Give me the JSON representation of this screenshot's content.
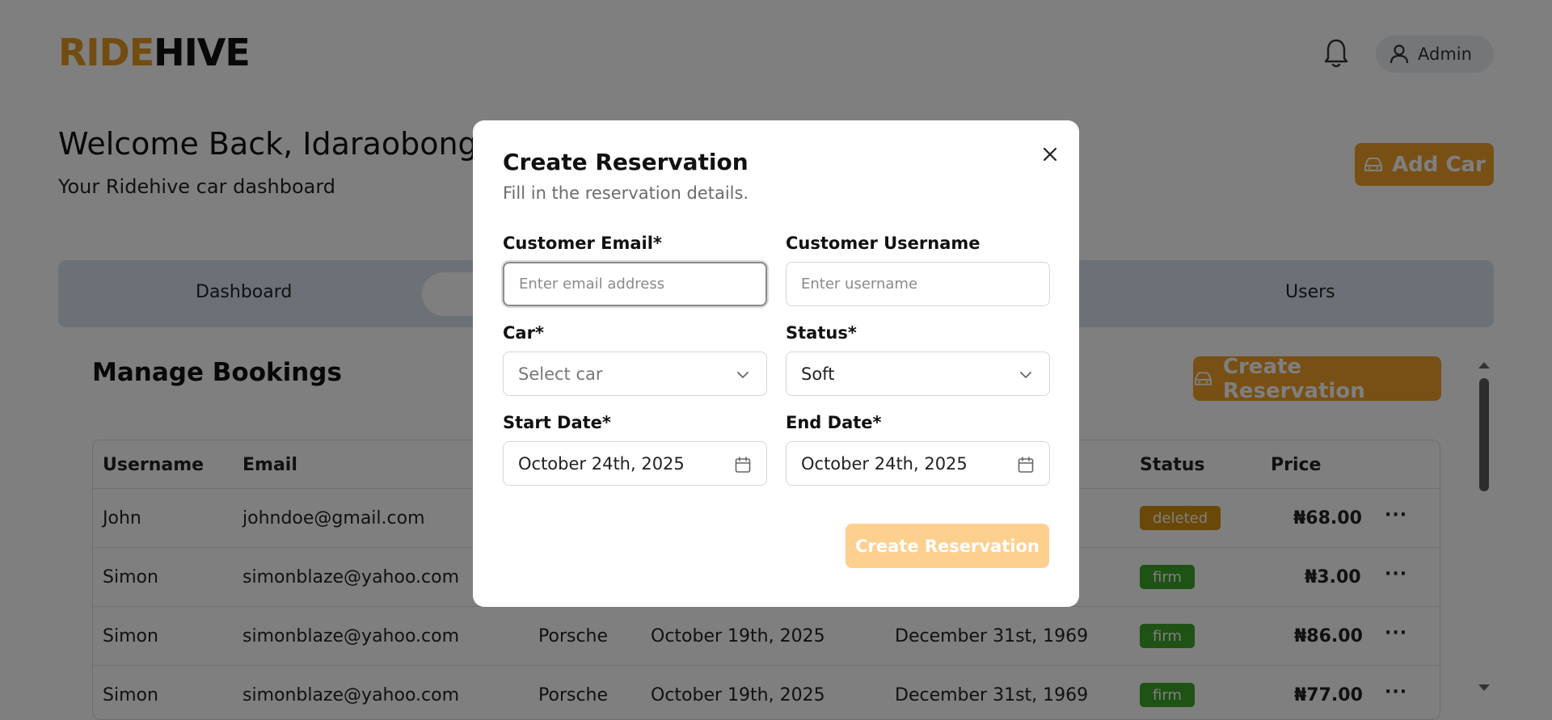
{
  "header": {
    "logo_part1": "RIDE",
    "logo_part2": "HIVE",
    "admin_label": "Admin"
  },
  "welcome": {
    "title": "Welcome Back, Idaraobong!",
    "subtitle": "Your Ridehive car dashboard"
  },
  "add_car_label": "Add Car",
  "tabs": [
    "Dashboard",
    "Users"
  ],
  "bookings": {
    "title": "Manage Bookings",
    "create_label": "Create Reservation",
    "columns": {
      "username": "Username",
      "email": "Email",
      "status": "Status",
      "price": "Price"
    },
    "rows": [
      {
        "username": "John",
        "email": "johndoe@gmail.com",
        "car": "",
        "start": "",
        "end": "",
        "status": "deleted",
        "price": "₦68.00"
      },
      {
        "username": "Simon",
        "email": "simonblaze@yahoo.com",
        "car": "",
        "start": "",
        "end": "",
        "status": "firm",
        "price": "₦3.00"
      },
      {
        "username": "Simon",
        "email": "simonblaze@yahoo.com",
        "car": "Porsche",
        "start": "October 19th, 2025",
        "end": "December 31st, 1969",
        "status": "firm",
        "price": "₦86.00"
      },
      {
        "username": "Simon",
        "email": "simonblaze@yahoo.com",
        "car": "Porsche",
        "start": "October 19th, 2025",
        "end": "December 31st, 1969",
        "status": "firm",
        "price": "₦77.00"
      }
    ],
    "row_actions": "···"
  },
  "colors": {
    "accent": "#f0a12a",
    "deleted_badge": "#d4900f",
    "firm_badge": "#3fa52b"
  },
  "modal": {
    "title": "Create Reservation",
    "subtitle": "Fill in the reservation details.",
    "email_label": "Customer Email*",
    "email_placeholder": "Enter email address",
    "username_label": "Customer Username",
    "username_placeholder": "Enter username",
    "car_label": "Car*",
    "car_placeholder": "Select car",
    "status_label": "Status*",
    "status_value": "Soft",
    "start_label": "Start Date*",
    "start_value": "October 24th, 2025",
    "end_label": "End Date*",
    "end_value": "October 24th, 2025",
    "submit_label": "Create Reservation"
  }
}
